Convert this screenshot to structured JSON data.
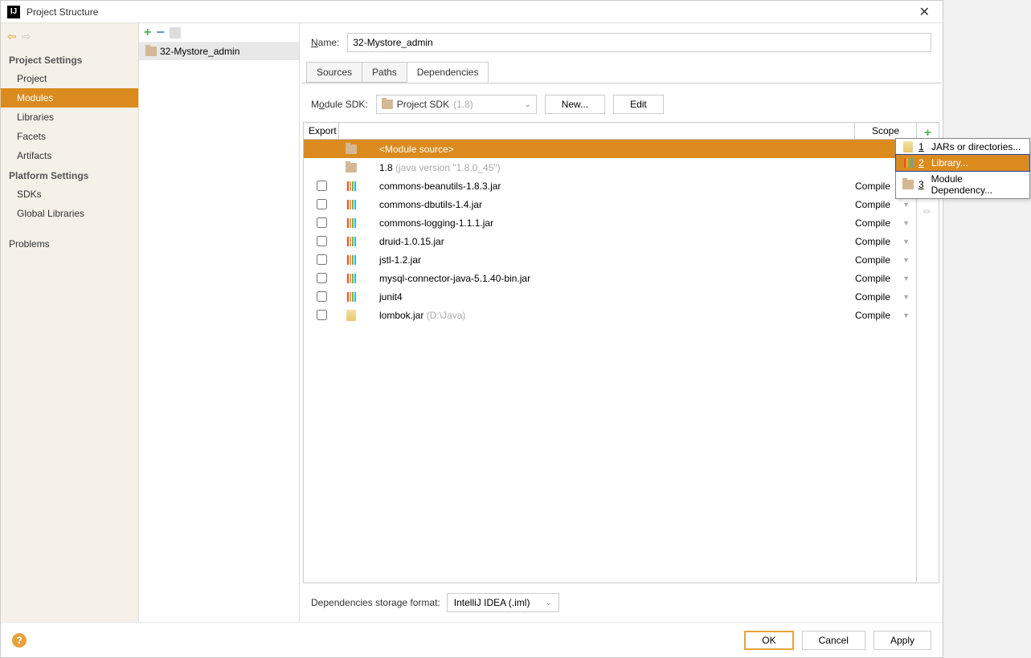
{
  "title": "Project Structure",
  "sidebar": {
    "headings": [
      "Project Settings",
      "Platform Settings"
    ],
    "project_items": [
      "Project",
      "Modules",
      "Libraries",
      "Facets",
      "Artifacts"
    ],
    "platform_items": [
      "SDKs",
      "Global Libraries"
    ],
    "problems": "Problems"
  },
  "tree": {
    "module": "32-Mystore_admin"
  },
  "name_label": "Name:",
  "name_value": "32-Mystore_admin",
  "tabs": [
    "Sources",
    "Paths",
    "Dependencies"
  ],
  "sdk": {
    "label_pre": "M",
    "label_u": "o",
    "label_post": "dule SDK:",
    "value": "Project SDK",
    "ver": "(1.8)",
    "new": "New...",
    "edit": "Edit"
  },
  "dep_head": {
    "export": "Export",
    "scope": "Scope"
  },
  "deps": [
    {
      "type": "module",
      "name": "<Module source>",
      "scope": "",
      "selected": true
    },
    {
      "type": "sdk",
      "name": "1.8",
      "extra": "(java version \"1.8.0_45\")",
      "scope": ""
    },
    {
      "type": "lib",
      "name": "commons-beanutils-1.8.3.jar",
      "scope": "Compile",
      "chk": true
    },
    {
      "type": "lib",
      "name": "commons-dbutils-1.4.jar",
      "scope": "Compile",
      "chk": true
    },
    {
      "type": "lib",
      "name": "commons-logging-1.1.1.jar",
      "scope": "Compile",
      "chk": true
    },
    {
      "type": "lib",
      "name": "druid-1.0.15.jar",
      "scope": "Compile",
      "chk": true
    },
    {
      "type": "lib",
      "name": "jstl-1.2.jar",
      "scope": "Compile",
      "chk": true
    },
    {
      "type": "lib",
      "name": "mysql-connector-java-5.1.40-bin.jar",
      "scope": "Compile",
      "chk": true
    },
    {
      "type": "lib",
      "name": "junit4",
      "scope": "Compile",
      "chk": true
    },
    {
      "type": "jar",
      "name": "lombok.jar",
      "extra": "(D:\\Java)",
      "scope": "Compile",
      "chk": true
    }
  ],
  "storage": {
    "label": "Dependencies storage format:",
    "value": "IntelliJ IDEA (.iml)"
  },
  "footer": {
    "ok": "OK",
    "cancel": "Cancel",
    "apply": "Apply"
  },
  "popup": [
    {
      "n": "1",
      "label": "JARs or directories..."
    },
    {
      "n": "2",
      "label": "Library...",
      "sel": true
    },
    {
      "n": "3",
      "label": "Module Dependency..."
    }
  ]
}
